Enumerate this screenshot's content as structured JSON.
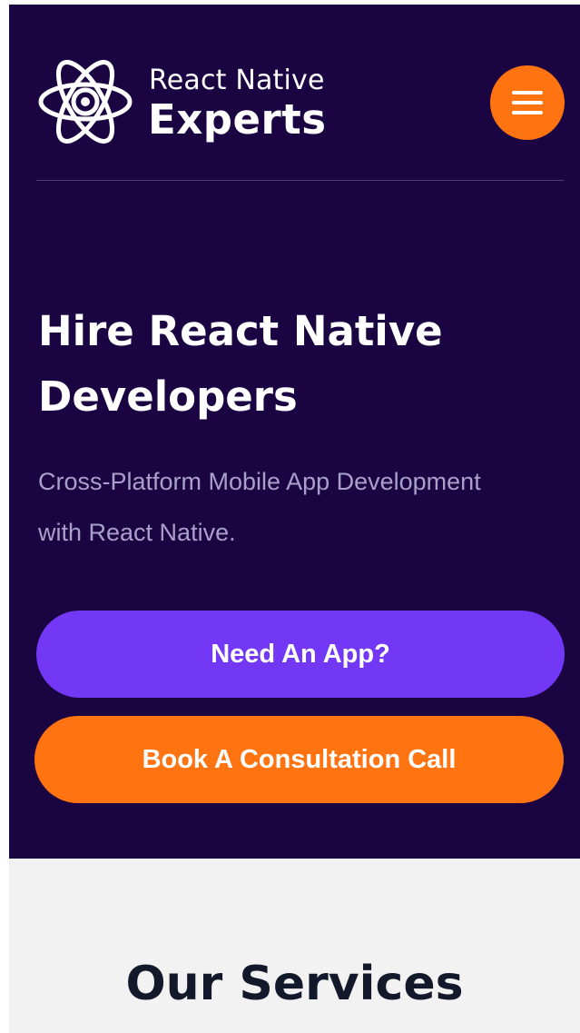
{
  "header": {
    "logo": {
      "icon": "atom-icon",
      "line1": "React Native",
      "line2": "Experts"
    },
    "menu_icon": "hamburger-menu-icon"
  },
  "hero": {
    "title": "Hire React Native Developers",
    "subtitle": "Cross-Platform Mobile App Development with React Native.",
    "primary_button": "Need An App?",
    "secondary_button": "Book A Consultation Call"
  },
  "services": {
    "heading": "Our Services"
  },
  "colors": {
    "hero_background": "#1b0442",
    "accent_orange": "#ff7310",
    "accent_purple": "#7337f6",
    "subtitle_text": "#a9a0c9",
    "services_background": "#f2f2f2",
    "services_heading": "#13192a"
  }
}
